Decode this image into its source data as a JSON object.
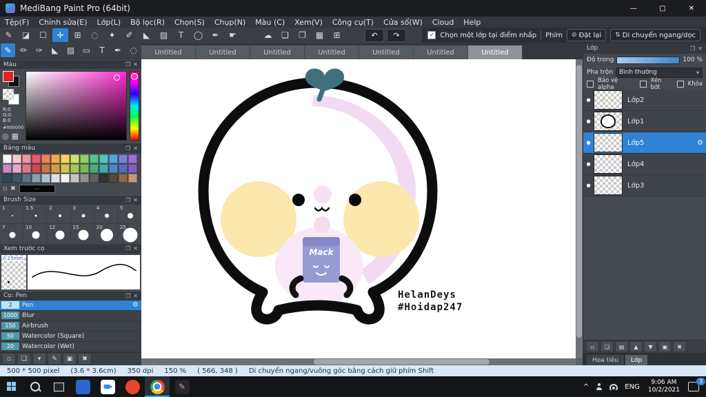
{
  "ui": {
    "popout_icon": "❐",
    "close_icon": "✕",
    "gear_icon": "⚙",
    "dot_icon": "●",
    "caret_down": "▾",
    "check": "✓",
    "ellipsis": "⋯",
    "spark_icon": "✦ ✦",
    "chevron_up": "^",
    "accent_color": "#2f82d4"
  },
  "titlebar": {
    "title": "MediBang Paint Pro (64bit)",
    "minimize_icon": "—",
    "maximize_icon": "□",
    "close_icon": "✕"
  },
  "menubar": {
    "items": [
      "Tệp(F)",
      "Chỉnh sửa(E)",
      "Lớp(L)",
      "Bộ lọc(R)",
      "Chọn(S)",
      "Chụp(N)",
      "Màu (C)",
      "Xem(V)",
      "Công cụ(T)",
      "Cửa sổ(W)",
      "Cloud",
      "Help"
    ]
  },
  "toolbar1": {
    "tools": [
      {
        "name": "pen-tool",
        "glyph": "✎"
      },
      {
        "name": "eraser-tool",
        "glyph": "◪"
      },
      {
        "name": "marquee-select-tool",
        "glyph": "☐"
      },
      {
        "name": "move-tool",
        "glyph": "✛"
      },
      {
        "name": "transform-tool",
        "glyph": "⊞"
      },
      {
        "name": "lasso-tool",
        "glyph": "◌"
      },
      {
        "name": "magic-wand-tool",
        "glyph": "✦"
      },
      {
        "name": "select-pen-tool",
        "glyph": "✐"
      },
      {
        "name": "bucket-tool",
        "glyph": "◣"
      },
      {
        "name": "gradient-tool",
        "glyph": "▨"
      },
      {
        "name": "text-tool",
        "glyph": "T"
      },
      {
        "name": "ellipse-tool",
        "glyph": "◯"
      },
      {
        "name": "eyedropper-tool",
        "glyph": "✒"
      },
      {
        "name": "hand-tool",
        "glyph": "☛"
      }
    ],
    "mid_tools": [
      {
        "name": "cloud-icon",
        "glyph": "☁"
      },
      {
        "name": "comment-icon",
        "glyph": "❏"
      },
      {
        "name": "material-icon",
        "glyph": "❐"
      },
      {
        "name": "grid-icon",
        "glyph": "▦"
      },
      {
        "name": "snap-grid-icon",
        "glyph": "⊞"
      }
    ],
    "undo_icon": "↶",
    "redo_icon": "↷",
    "select_layer_checkbox": "Chọn một lớp tại điểm nhấp",
    "phim_label": "Phím",
    "reset_button": "Đặt lại",
    "reset_icon": "⊘",
    "move_button": "Di chuyển ngang/dọc",
    "move_icon": "⇅"
  },
  "toolbar2": {
    "tools": [
      {
        "name": "pen-brush",
        "glyph": "✎"
      },
      {
        "name": "pencil-brush",
        "glyph": "✏"
      },
      {
        "name": "airbrush",
        "glyph": "✑"
      },
      {
        "name": "bucket-tool",
        "glyph": "◣"
      },
      {
        "name": "gradient-tool",
        "glyph": "▨"
      },
      {
        "name": "shape-tool",
        "glyph": "▭"
      },
      {
        "name": "text-tool",
        "glyph": "T"
      },
      {
        "name": "eyedropper-tool",
        "glyph": "✒"
      },
      {
        "name": "select-tool",
        "glyph": "◌"
      }
    ]
  },
  "tabs": {
    "items": [
      "Untitled",
      "Untitled",
      "Untitled",
      "Untitled",
      "Untitled",
      "Untitled",
      "Untitled"
    ]
  },
  "color_panel": {
    "title": "Màu",
    "r": "R:0",
    "g": "G:0",
    "b": "B:0",
    "hex": "#000000",
    "hue_color": "#ff2fd0",
    "icons": [
      {
        "name": "color-wheel-icon",
        "glyph": "◎"
      },
      {
        "name": "palette-grid-icon",
        "glyph": "▦"
      }
    ]
  },
  "palette_panel": {
    "title": "Bảng màu",
    "current_label": "⋯",
    "swatches": [
      "#f8f8f2",
      "#f6c9cf",
      "#ef93a4",
      "#e85a72",
      "#f0825a",
      "#f2a852",
      "#f5d45e",
      "#cfe06a",
      "#93d06a",
      "#5dc08a",
      "#54c2c2",
      "#5aa4da",
      "#7486d4",
      "#9a72d0",
      "#c98ac0",
      "#e8a8c8",
      "#d87888",
      "#c05050",
      "#c87840",
      "#d0a048",
      "#d8c456",
      "#a8c85c",
      "#78b85c",
      "#50a87c",
      "#48a8a8",
      "#4c88c0",
      "#5c6cbc",
      "#8460bc",
      "#2e4858",
      "#3c5868",
      "#5c7484",
      "#84a0ae",
      "#b0c2ca",
      "#d8e2e6",
      "#f2f2f2",
      "#c4c4c4",
      "#929292",
      "#606060",
      "#333333",
      "#594a38",
      "#8a6a4a",
      "#c29a78"
    ],
    "icons": [
      {
        "name": "add-swatch-icon",
        "glyph": "▫"
      },
      {
        "name": "delete-swatch-icon",
        "glyph": "✖"
      }
    ]
  },
  "brush_size_panel": {
    "title": "Brush Size",
    "sizes": [
      "1",
      "1.5",
      "2",
      "3",
      "4",
      "5",
      "7",
      "10",
      "12",
      "15",
      "20",
      "25"
    ]
  },
  "preview_panel": {
    "title": "Xem trước cọ",
    "size_label": "0.15mm"
  },
  "brush_panel": {
    "title": "Cọ: Pen",
    "brushes": [
      {
        "size": "2",
        "name": "Pen"
      },
      {
        "size": "1000",
        "name": "Blur"
      },
      {
        "size": "150",
        "name": "Airbrush"
      },
      {
        "size": "50",
        "name": "Watercolor (Square)"
      },
      {
        "size": "20",
        "name": "Watercolor (Wet)"
      }
    ]
  },
  "bottom_bar": {
    "icons": [
      {
        "name": "new-brush-icon",
        "glyph": "▫"
      },
      {
        "name": "duplicate-brush-icon",
        "glyph": "❏"
      },
      {
        "name": "brush-menu-icon",
        "glyph": "▾"
      },
      {
        "name": "edit-brush-icon",
        "glyph": "✎"
      },
      {
        "name": "brush-folder-icon",
        "glyph": "▣"
      },
      {
        "name": "delete-brush-icon",
        "glyph": "✖"
      }
    ]
  },
  "layers_panel": {
    "title": "Lớp",
    "opacity_label": "Độ trong",
    "opacity_value": "100 %",
    "blend_label": "Pha trộn",
    "blend_value": "Bình thường",
    "alpha_lock_label": "Bảo vệ alpha",
    "clip_label": "Xén bớt",
    "lock_label": "Khóa",
    "layers": [
      {
        "name": "Lớp2"
      },
      {
        "name": "Lớp1"
      },
      {
        "name": "Lớp5"
      },
      {
        "name": "Lớp4"
      },
      {
        "name": "Lớp3"
      }
    ],
    "layer_icons": [
      {
        "name": "new-layer-icon",
        "glyph": "▫"
      },
      {
        "name": "duplicate-layer-icon",
        "glyph": "❏"
      },
      {
        "name": "merge-layer-icon",
        "glyph": "▤"
      },
      {
        "name": "layer-up-icon",
        "glyph": "▲"
      },
      {
        "name": "layer-down-icon",
        "glyph": "▼"
      },
      {
        "name": "layer-folder-icon",
        "glyph": "▣"
      },
      {
        "name": "delete-layer-icon",
        "glyph": "✖"
      }
    ],
    "bottom_tabs": [
      "Hoa tiêu",
      "Lớp"
    ]
  },
  "canvas": {
    "artist_line1": "HelanDeys",
    "artist_line2": "#Hoidap247",
    "carton_text": "Mack"
  },
  "statusbar": {
    "segments": [
      "500 * 500 pixel",
      "(3.6 * 3.6cm)",
      "350 dpi",
      "150 %",
      "( 566, 348 )",
      "Di chuyển ngang/vuông góc bằng cách giữ phím Shift"
    ]
  },
  "taskbar": {
    "lang": "ENG",
    "time": "9:06 AM",
    "date": "10/2/2021",
    "badge": "3",
    "apps": [
      {
        "name": "zalo-app",
        "color": "#2e66d0"
      },
      {
        "name": "zoom-app",
        "color": "#ffffff"
      },
      {
        "name": "firefox-app",
        "color": "#e8452c"
      },
      {
        "name": "chrome-app",
        "color": "#4285f4"
      },
      {
        "name": "medibang-app",
        "color": "#23262b"
      }
    ]
  }
}
